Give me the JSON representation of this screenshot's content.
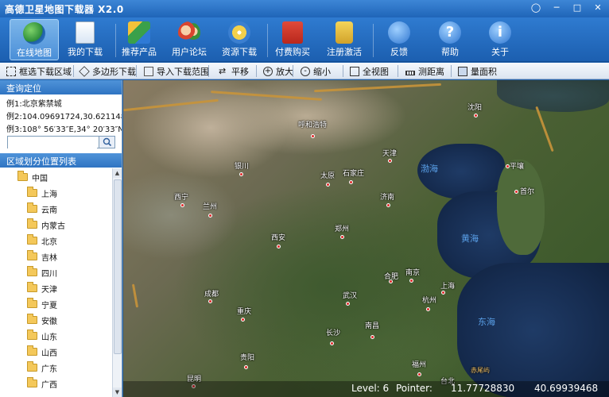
{
  "window": {
    "title": "高德卫星地图下载器 X2.0"
  },
  "toolbar": {
    "items": [
      {
        "label": "在线地图",
        "icon": "globe-icon"
      },
      {
        "label": "我的下载",
        "icon": "document-icon"
      },
      {
        "label": "推荐产品",
        "icon": "cubes-icon"
      },
      {
        "label": "用户论坛",
        "icon": "users-icon"
      },
      {
        "label": "资源下载",
        "icon": "disc-icon"
      },
      {
        "label": "付费购买",
        "icon": "cart-icon"
      },
      {
        "label": "注册激活",
        "icon": "lock-icon"
      },
      {
        "label": "反馈",
        "icon": "feedback-icon"
      },
      {
        "label": "帮助",
        "icon": "help-icon"
      },
      {
        "label": "关于",
        "icon": "info-icon"
      }
    ]
  },
  "tools": [
    {
      "label": "框选下载区域",
      "icon": "rect-select-icon"
    },
    {
      "label": "多边形下载",
      "icon": "polygon-icon"
    },
    {
      "label": "导入下载范围",
      "icon": "import-icon"
    },
    {
      "label": "平移",
      "icon": "pan-icon"
    },
    {
      "label": "放大",
      "icon": "zoom-in-icon"
    },
    {
      "label": "缩小",
      "icon": "zoom-out-icon"
    },
    {
      "label": "全视图",
      "icon": "full-view-icon"
    },
    {
      "label": "测距离",
      "icon": "ruler-icon"
    },
    {
      "label": "量面积",
      "icon": "area-icon"
    }
  ],
  "query": {
    "header": "查询定位",
    "examples": [
      "例1:北京紫禁城",
      "例2:104.09691724,30.62114865",
      "例3:108° 56′33″E,34° 20′33″N"
    ],
    "search_value": ""
  },
  "region": {
    "header": "区域划分位置列表",
    "root": "中国",
    "provinces": [
      "上海",
      "云南",
      "内蒙古",
      "北京",
      "吉林",
      "四川",
      "天津",
      "宁夏",
      "安徽",
      "山东",
      "山西",
      "广东",
      "广西"
    ]
  },
  "map": {
    "cities": [
      "呼和浩特",
      "沈阳",
      "天津",
      "银川",
      "太原",
      "石家庄",
      "西宁",
      "兰州",
      "济南",
      "平壤",
      "首尔",
      "西安",
      "郑州",
      "合肥",
      "南京",
      "上海",
      "成都",
      "武汉",
      "杭州",
      "重庆",
      "长沙",
      "南昌",
      "贵阳",
      "昆明",
      "福州",
      "台北"
    ],
    "seas": [
      "渤海",
      "黄海",
      "东海"
    ],
    "note": "赤尾屿",
    "status": {
      "level": "Level: 6",
      "pointer_label": "Pointer:",
      "lon": "11.77728830",
      "lat": "40.69939468"
    }
  },
  "colors": {
    "accent": "#1f65b8",
    "header": "#2f74c2",
    "border": "#c8943a",
    "city": "#e02a2a"
  }
}
